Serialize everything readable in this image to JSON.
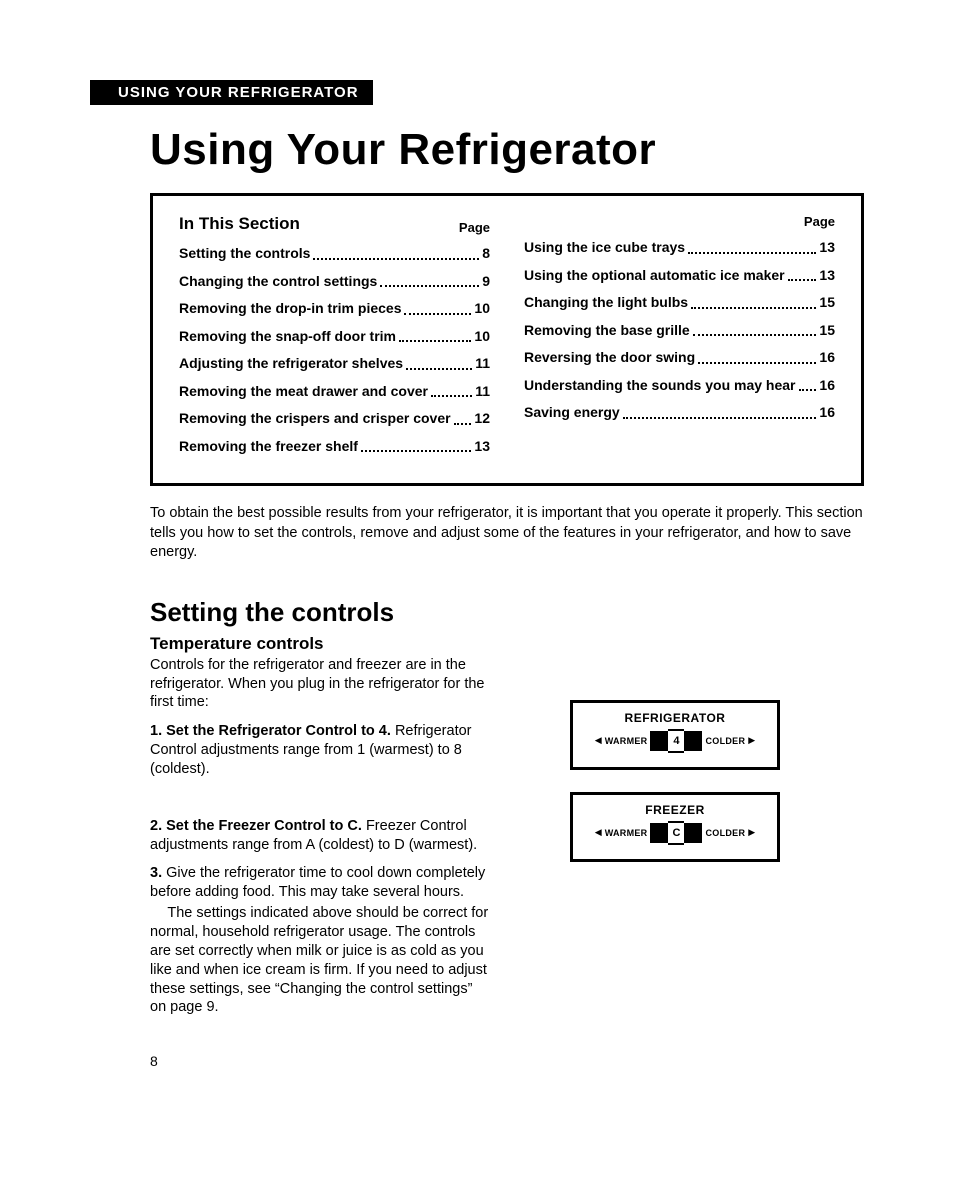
{
  "header_tab": "USING YOUR REFRIGERATOR",
  "main_title": "Using Your Refrigerator",
  "toc": {
    "section_title": "In This Section",
    "page_label": "Page",
    "left": [
      {
        "label": "Setting the controls",
        "page": "8"
      },
      {
        "label": "Changing the control settings",
        "page": "9"
      },
      {
        "label": "Removing the drop-in trim pieces",
        "page": "10"
      },
      {
        "label": "Removing the snap-off door trim",
        "page": "10"
      },
      {
        "label": "Adjusting the refrigerator shelves",
        "page": "11"
      },
      {
        "label": "Removing the meat drawer and cover",
        "page": "11"
      },
      {
        "label": "Removing the crispers and crisper cover",
        "page": "12"
      },
      {
        "label": "Removing the freezer shelf",
        "page": "13"
      }
    ],
    "right": [
      {
        "label": "Using the ice cube trays",
        "page": "13"
      },
      {
        "label": "Using the optional automatic ice maker",
        "page": "13"
      },
      {
        "label": "Changing the light bulbs",
        "page": "15"
      },
      {
        "label": "Removing the base grille",
        "page": "15"
      },
      {
        "label": "Reversing the door swing",
        "page": "16"
      },
      {
        "label": "Understanding the sounds you may hear",
        "page": "16"
      },
      {
        "label": "Saving energy",
        "page": "16"
      }
    ]
  },
  "intro": "To obtain the best possible results from your refrigerator, it is important that you operate it properly. This section tells you how to set the controls, remove and adjust some of the features in your refrigerator, and how to save energy.",
  "section1_title": "Setting the controls",
  "section1_sub": "Temperature controls",
  "section1_intro": "Controls for the refrigerator and freezer are in the refrigerator. When you plug in the refrigerator for the first time:",
  "steps": {
    "s1_num": "1.",
    "s1_lead": "Set the Refrigerator Control to 4.",
    "s1_body": "Refrigerator Control adjustments range from 1 (warmest) to 8 (coldest).",
    "s2_num": "2.",
    "s2_lead": "Set the Freezer Control to C.",
    "s2_body": "Freezer Control adjustments range from A (coldest) to D (warmest).",
    "s3_num": "3.",
    "s3_body": "Give the refrigerator time to cool down completely before adding food. This may take several hours.",
    "s3_extra": "The settings indicated above should be correct for normal, household refrigerator usage. The controls are set correctly when milk or juice is as cold as you like and when ice cream is firm. If you need to adjust these settings, see “Changing the control settings” on page 9."
  },
  "controls": {
    "fridge_title": "REFRIGERATOR",
    "freezer_title": "FREEZER",
    "warmer": "WARMER",
    "colder": "COLDER",
    "fridge_value": "4",
    "freezer_value": "C",
    "left_arrow": "◀",
    "right_arrow": "▶"
  },
  "page_number": "8"
}
